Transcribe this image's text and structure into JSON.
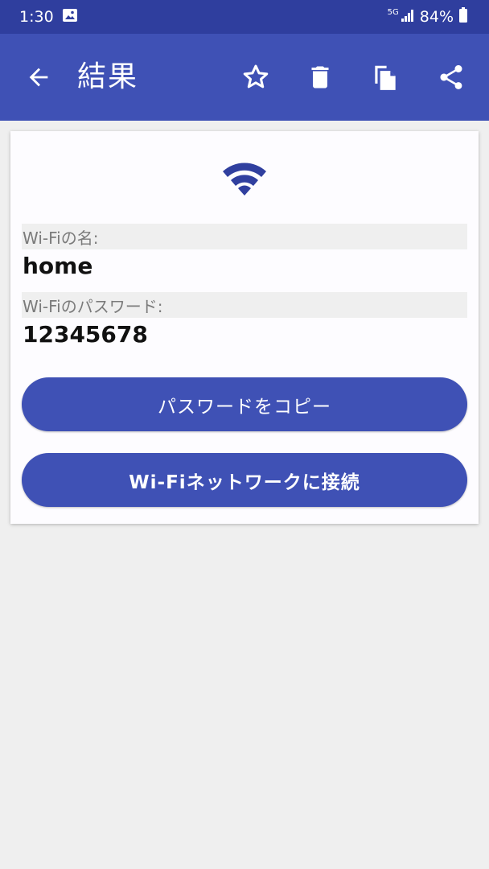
{
  "status_bar": {
    "time": "1:30",
    "network": "5G",
    "battery": "84%"
  },
  "app_bar": {
    "title": "結果"
  },
  "result": {
    "ssid_label": "Wi-Fiの名:",
    "ssid_value": "home",
    "password_label": "Wi-Fiのパスワード:",
    "password_value": "12345678"
  },
  "buttons": {
    "copy_password": "パスワードをコピー",
    "connect_wifi": "Wi-Fiネットワークに接続"
  },
  "colors": {
    "primary": "#3f51b5",
    "primary_dark": "#2f3e9e",
    "background": "#efefef",
    "card": "#fdfcff"
  }
}
